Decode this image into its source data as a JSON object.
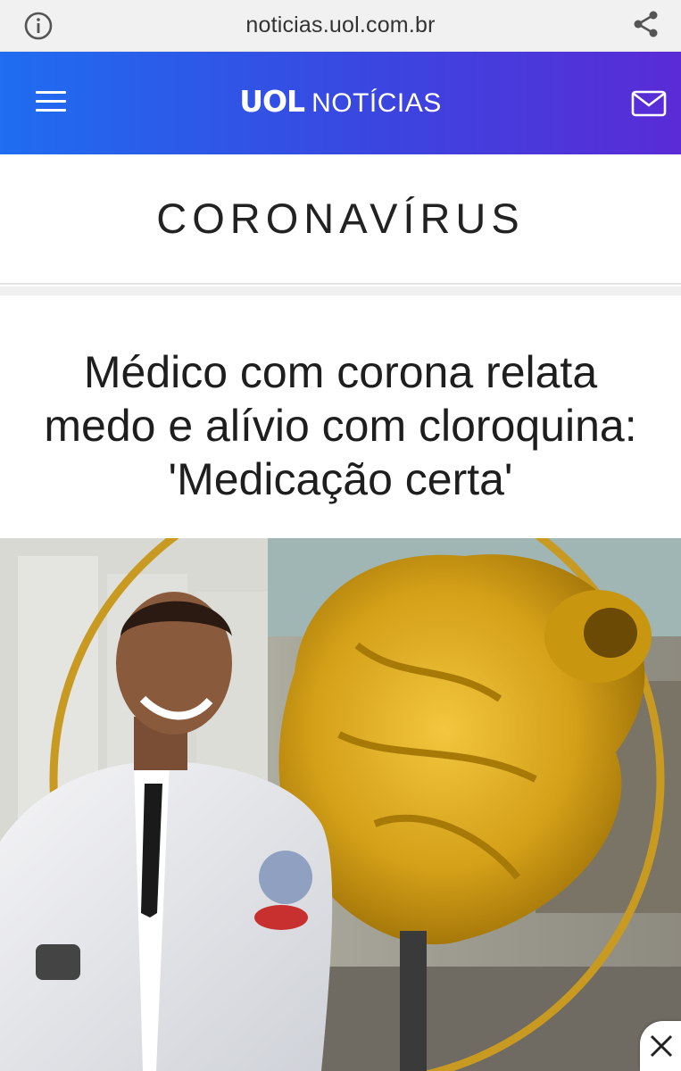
{
  "browser": {
    "url": "noticias.uol.com.br",
    "info_icon": "info-icon",
    "share_icon": "share-icon"
  },
  "header": {
    "logo": "UOL",
    "section": "NOTÍCIAS",
    "menu_icon": "hamburger-menu-icon",
    "mail_icon": "mail-icon",
    "gradient_start": "#1f6df0",
    "gradient_end": "#5a2bd6"
  },
  "category": {
    "title": "CORONAVÍRUS"
  },
  "article": {
    "headline_line1": "Médico com corona relata",
    "headline_line2": "medo e alívio com cloroquina:",
    "headline_line3": "'Medicação certa'"
  },
  "photo": {
    "description_icon": "article-photo"
  },
  "overlay": {
    "close_icon": "close-icon"
  }
}
